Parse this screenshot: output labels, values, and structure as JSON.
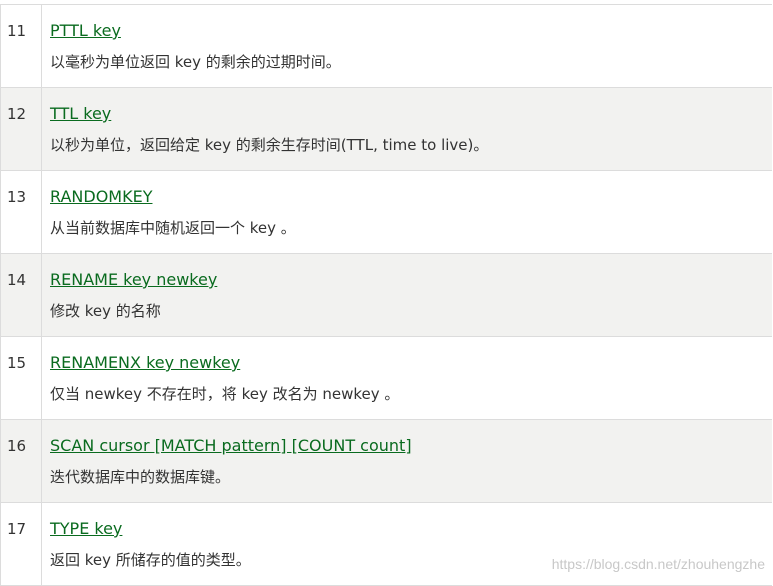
{
  "rows": [
    {
      "num": "11",
      "command": "PTTL key",
      "description": "以毫秒为单位返回 key 的剩余的过期时间。"
    },
    {
      "num": "12",
      "command": "TTL key",
      "description": "以秒为单位，返回给定 key 的剩余生存时间(TTL, time to live)。"
    },
    {
      "num": "13",
      "command": "RANDOMKEY",
      "description": "从当前数据库中随机返回一个 key 。"
    },
    {
      "num": "14",
      "command": "RENAME key newkey",
      "description": "修改 key 的名称"
    },
    {
      "num": "15",
      "command": "RENAMENX key newkey",
      "description": "仅当 newkey 不存在时，将 key 改名为 newkey 。"
    },
    {
      "num": "16",
      "command": "SCAN cursor [MATCH pattern] [COUNT count]",
      "description": "迭代数据库中的数据库键。"
    },
    {
      "num": "17",
      "command": "TYPE key",
      "description": "返回 key 所储存的值的类型。"
    }
  ],
  "watermark": "https://blog.csdn.net/zhouhengzhe"
}
